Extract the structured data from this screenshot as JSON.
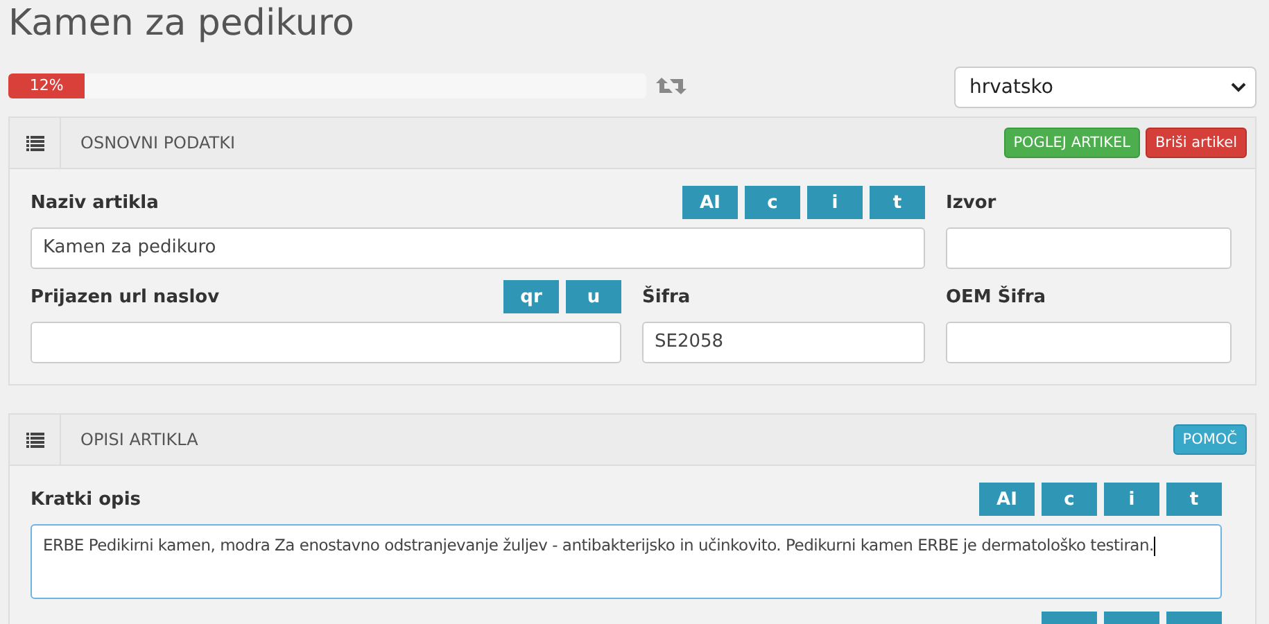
{
  "page_title": "Kamen za pedikuro",
  "progress": {
    "level": 0.12,
    "label": "12%"
  },
  "language_select": {
    "value": "hrvatsko"
  },
  "panels": [
    {
      "title": "OSNOVNI PODATKI",
      "actions": [
        {
          "label": "POGLEJ ARTIKEL",
          "kind": "success"
        },
        {
          "label": "Briši artikel",
          "kind": "danger"
        }
      ],
      "fields": [
        {
          "kind": "wide",
          "label": "Naziv artikla",
          "value": "Kamen za pedikuro",
          "tools": [
            "AI",
            "c",
            "i",
            "t"
          ]
        },
        {
          "kind": "input",
          "label": "Izvor"
        },
        {
          "kind": "input",
          "label": "Prijazen url naslov",
          "tools": [
            "qr",
            "u"
          ]
        },
        {
          "kind": "input",
          "label": "Šifra",
          "value": "SE2058"
        },
        {
          "kind": "input",
          "label": "OEM Šifra"
        }
      ]
    },
    {
      "title": "OPISI ARTIKLA",
      "actions": [
        {
          "label": "POMOČ",
          "kind": "info"
        }
      ],
      "fields": [
        {
          "kind": "textarea",
          "label": "Kratki opis",
          "value": "ERBE Pedikirni kamen, modra Za enostavno odstranjevanje žuljev - antibakterijsko in učinkovito. Pedikurni kamen ERBE je dermatološko testiran.",
          "tools": [
            "AI",
            "c",
            "i",
            "t"
          ]
        }
      ]
    }
  ]
}
